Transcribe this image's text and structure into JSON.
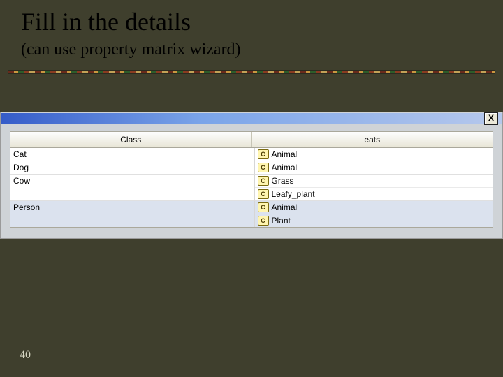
{
  "title": "Fill in the details",
  "subtitle": "(can use property matrix wizard)",
  "close_label": "X",
  "page_number": "40",
  "headers": {
    "class": "Class",
    "eats": "eats"
  },
  "rows": [
    {
      "class_name": "Cat",
      "selected": false,
      "eats": [
        {
          "badge": "C",
          "label": "Animal"
        }
      ]
    },
    {
      "class_name": "Dog",
      "selected": false,
      "eats": [
        {
          "badge": "C",
          "label": "Animal"
        }
      ]
    },
    {
      "class_name": "Cow",
      "selected": false,
      "eats": [
        {
          "badge": "C",
          "label": "Grass"
        },
        {
          "badge": "C",
          "label": "Leafy_plant"
        }
      ]
    },
    {
      "class_name": "Person",
      "selected": true,
      "eats": [
        {
          "badge": "C",
          "label": "Animal"
        },
        {
          "badge": "C",
          "label": "Plant"
        }
      ]
    }
  ]
}
